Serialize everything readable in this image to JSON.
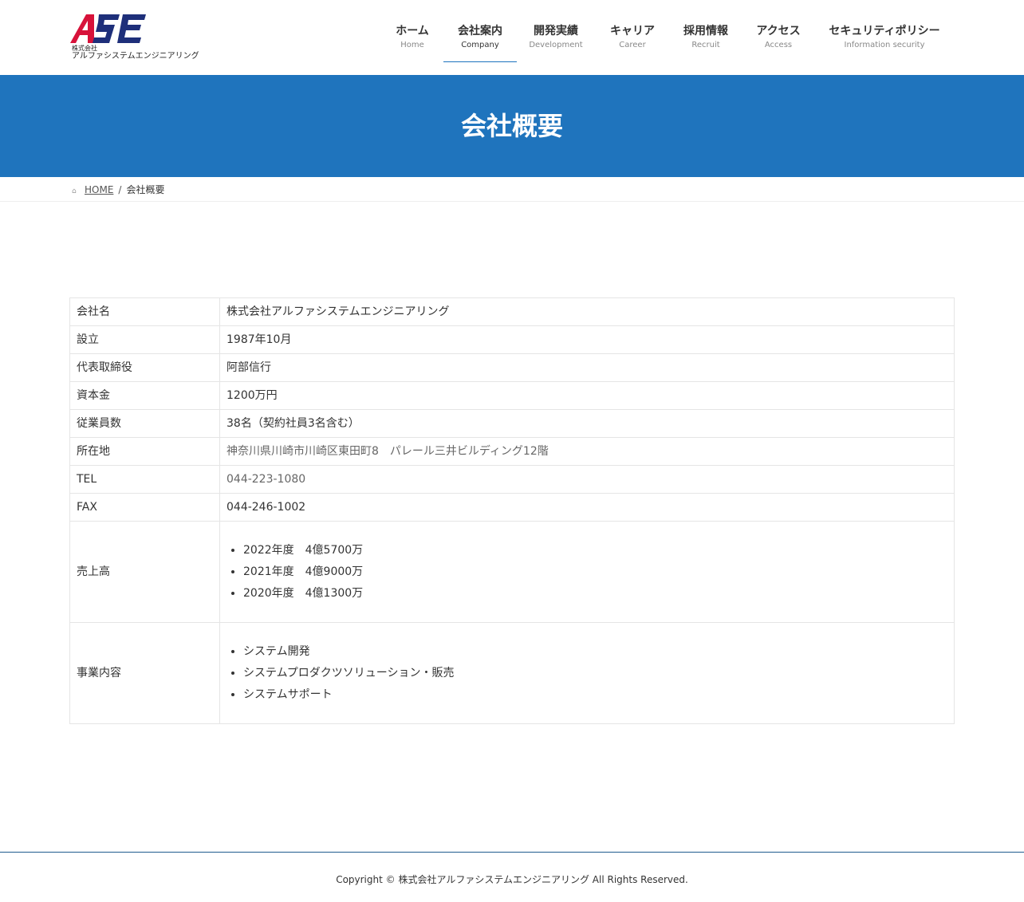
{
  "brand": {
    "logo_mark": "ASE",
    "logo_small": "株式会社",
    "logo_name": "アルファシステムエンジニアリング",
    "mark_colors": {
      "red": "#d7123a",
      "navy": "#1e2f7a"
    }
  },
  "nav": [
    {
      "jp": "ホーム",
      "en": "Home"
    },
    {
      "jp": "会社案内",
      "en": "Company",
      "active": true
    },
    {
      "jp": "開発実績",
      "en": "Development"
    },
    {
      "jp": "キャリア",
      "en": "Career"
    },
    {
      "jp": "採用情報",
      "en": "Recruit"
    },
    {
      "jp": "アクセス",
      "en": "Access"
    },
    {
      "jp": "セキュリティポリシー",
      "en": "Information security"
    }
  ],
  "page": {
    "title": "会社概要"
  },
  "breadcrumb": {
    "home_icon": "home-icon",
    "home": "HOME",
    "separator": "/",
    "current": "会社概要"
  },
  "company": {
    "rows": [
      {
        "label": "会社名",
        "value": "株式会社アルファシステムエンジニアリング"
      },
      {
        "label": "設立",
        "value": "1987年10月"
      },
      {
        "label": "代表取締役",
        "value": "阿部信行"
      },
      {
        "label": "資本金",
        "value": "1200万円"
      },
      {
        "label": "従業員数",
        "value": "38名（契約社員3名含む）"
      },
      {
        "label": "所在地",
        "value": "神奈川県川崎市川崎区東田町8　パレール三井ビルディング12階"
      },
      {
        "label": "TEL",
        "value": "044-223-1080"
      },
      {
        "label": "FAX",
        "value": "044-246-1002"
      }
    ],
    "sales": {
      "label": "売上高",
      "items": [
        "2022年度　4億5700万",
        "2021年度　4億9000万",
        "2020年度　4億1300万"
      ]
    },
    "business": {
      "label": "事業内容",
      "items": [
        "システム開発",
        "システムプロダクツソリューション・販売",
        "システムサポート"
      ]
    }
  },
  "footer": {
    "copyright": "Copyright © 株式会社アルファシステムエンジニアリング All Rights Reserved."
  },
  "colors": {
    "accent": "#1f74bd",
    "footer_line": "#1f5a8e"
  }
}
